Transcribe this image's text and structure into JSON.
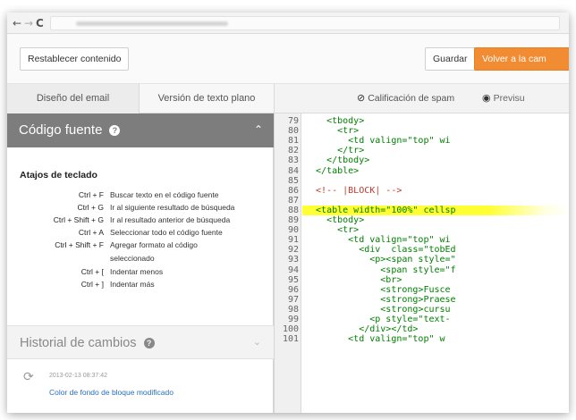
{
  "toolbar": {
    "reset_label": "Restablecer contenido",
    "save_label": "Guardar",
    "back_label": "Volver a la cam"
  },
  "tabs": {
    "email_design": "Diseño del email",
    "text_version": "Versión de texto plano"
  },
  "right_tabs": {
    "spam_label": "Calificación de spam",
    "preview_label": "Previsu"
  },
  "source": {
    "title": "Código fuente",
    "shortcuts_heading": "Atajos de teclado",
    "shortcuts": [
      {
        "keys": "Ctrl + F",
        "desc": "Buscar texto en el código fuente"
      },
      {
        "keys": "Ctrl + G",
        "desc": "Ir al siguiente resultado de búsqueda"
      },
      {
        "keys": "Ctrl + Shift + G",
        "desc": "Ir al resultado anterior de búsqueda"
      },
      {
        "keys": "Ctrl + A",
        "desc": "Seleccionar todo el código fuente"
      },
      {
        "keys": "Ctrl + Shift + F",
        "desc": "Agregar formato al código seleccionado"
      },
      {
        "keys": "Ctrl + [",
        "desc": "Indentar menos"
      },
      {
        "keys": "Ctrl + ]",
        "desc": "Indentar más"
      }
    ]
  },
  "history": {
    "title": "Historial de cambios",
    "entries": [
      {
        "time": "2013-02-13 08:37:42",
        "desc": "Color de fondo de bloque modificado"
      }
    ]
  },
  "code": {
    "lines": [
      {
        "n": "79",
        "text": "    <tbody>"
      },
      {
        "n": "80",
        "text": "      <tr>"
      },
      {
        "n": "81",
        "text": "        <td valign=\"top\" wi"
      },
      {
        "n": "82",
        "text": "      </tr>"
      },
      {
        "n": "83",
        "text": "    </tbody>"
      },
      {
        "n": "84",
        "text": "  </table>"
      },
      {
        "n": "85",
        "text": ""
      },
      {
        "n": "86",
        "text": "  <!-- |BLOCK| -->"
      },
      {
        "n": "87",
        "text": ""
      },
      {
        "n": "88",
        "text": "  <table width=\"100%\" cellsp"
      },
      {
        "n": "89",
        "text": "    <tbody>"
      },
      {
        "n": "90",
        "text": "      <tr>"
      },
      {
        "n": "91",
        "text": "        <td valign=\"top\" wi"
      },
      {
        "n": "92",
        "text": "          <div  class=\"tobEd"
      },
      {
        "n": "93",
        "text": "            <p><span style=\""
      },
      {
        "n": "94",
        "text": "              <span style=\"f"
      },
      {
        "n": "95",
        "text": "              <br>"
      },
      {
        "n": "96",
        "text": "              <strong>Fusce"
      },
      {
        "n": "97",
        "text": "              <strong>Praese"
      },
      {
        "n": "98",
        "text": "              <strong>cursu"
      },
      {
        "n": "99",
        "text": "            <p style=\"text-"
      },
      {
        "n": "100",
        "text": "          </div></td>"
      },
      {
        "n": "101",
        "text": "        <td valign=\"top\" w"
      }
    ],
    "highlight_line": "88",
    "comment_line": "86"
  },
  "colors": {
    "accent_orange": "#f28c33",
    "panel_header": "#7d7d7d",
    "code_green": "#008000",
    "highlight": "#ffff33",
    "link_blue": "#2a6ebb"
  }
}
